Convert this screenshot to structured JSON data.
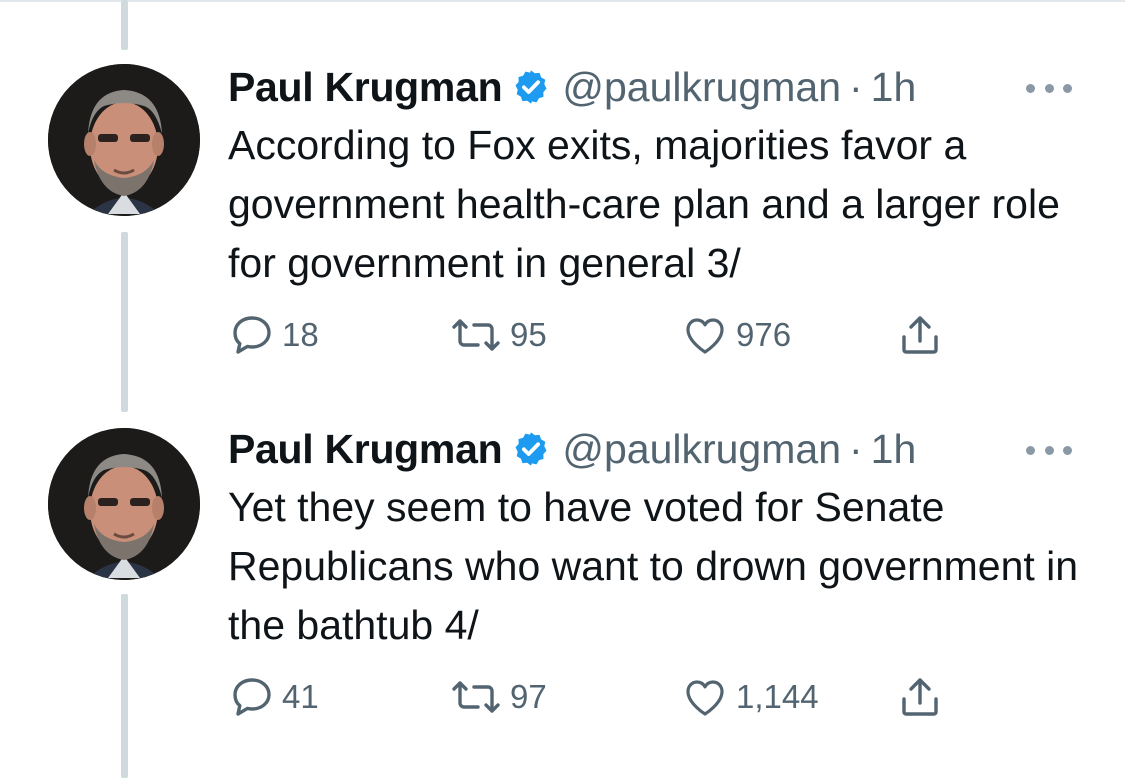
{
  "colors": {
    "verified": "#1d9bf0",
    "secondary_text": "#536471",
    "thread_line": "#cfd9de",
    "icon_gray": "#536471"
  },
  "tweets": [
    {
      "name": "Paul Krugman",
      "handle": "@paulkrugman",
      "separator": "·",
      "time": "1h",
      "text": "According to Fox exits, majorities favor a government health-care plan and a larger role for government in general 3/",
      "replies": "18",
      "retweets": "95",
      "likes": "976"
    },
    {
      "name": "Paul Krugman",
      "handle": "@paulkrugman",
      "separator": "·",
      "time": "1h",
      "text": "Yet they seem to have voted for Senate Republicans who want to drown government in the bathtub 4/",
      "replies": "41",
      "retweets": "97",
      "likes": "1,144"
    }
  ],
  "icons": {
    "verified": "verified-badge-icon",
    "more": "more-options-icon",
    "reply": "reply-icon",
    "retweet": "retweet-icon",
    "like": "heart-icon",
    "share": "share-icon"
  }
}
